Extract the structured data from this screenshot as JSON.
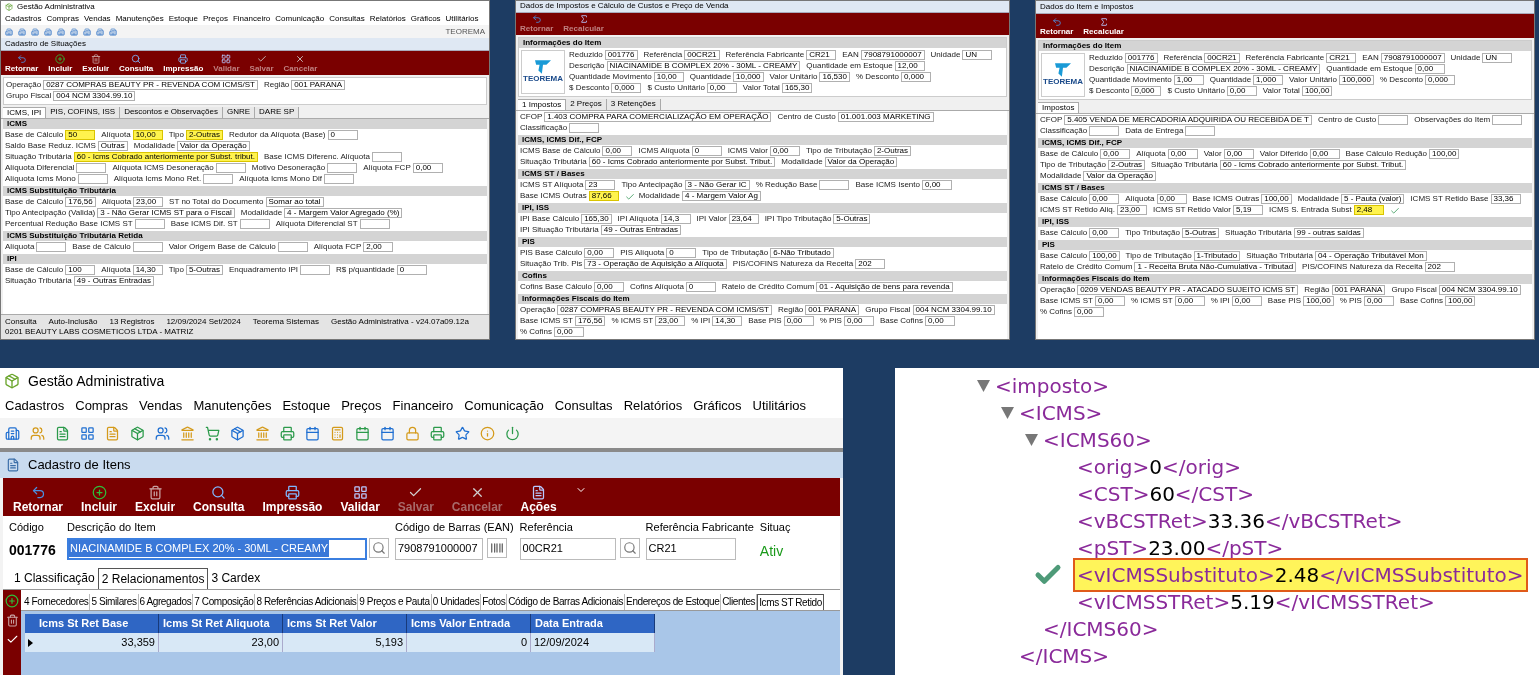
{
  "thumbnails": [
    {
      "app_title": "Gestão Administrativa",
      "menu": [
        "Cadastros",
        "Compras",
        "Vendas",
        "Manutenções",
        "Estoque",
        "Preços",
        "Financeiro",
        "Comunicação",
        "Consultas",
        "Relatórios",
        "Gráficos",
        "Utilitários"
      ],
      "brand": "TEOREMA",
      "window_title": "Cadastro de Situações",
      "check_mark": false,
      "toolbar": [
        {
          "label": "Retornar",
          "kind": "back",
          "disabled": false
        },
        {
          "label": "Incluir",
          "kind": "add",
          "disabled": false
        },
        {
          "label": "Excluir",
          "kind": "delete",
          "disabled": false
        },
        {
          "label": "Consulta",
          "kind": "search",
          "disabled": false
        },
        {
          "label": "Impressão",
          "kind": "print",
          "disabled": false
        },
        {
          "label": "Validar",
          "kind": "validate",
          "disabled": true
        },
        {
          "label": "Salvar",
          "kind": "save",
          "disabled": true
        },
        {
          "label": "Cancelar",
          "kind": "cancel",
          "disabled": true
        }
      ],
      "header": {
        "fields": [
          {
            "label": "Operação",
            "value": "0287 COMPRAS BEAUTY PR - REVENDA COM ICMS/ST",
            "highlighted": false
          },
          {
            "label": "Região",
            "value": "001 PARANA",
            "highlighted": false
          },
          {
            "label": "Grupo Fiscal",
            "value": "004 NCM 3304.99.10",
            "highlighted": false
          }
        ]
      },
      "tabs": [
        {
          "label": "ICMS, IPI",
          "selected": true
        },
        {
          "label": "PIS, COFINS, ISS",
          "selected": false
        },
        {
          "label": "Descontos e Observações",
          "selected": false
        },
        {
          "label": "GNRE",
          "selected": false
        },
        {
          "label": "DARE SP",
          "selected": false
        }
      ],
      "sections": [
        {
          "title": "ICMS",
          "fields": [
            {
              "label": "Base de Cálculo",
              "value": "50",
              "highlighted": true
            },
            {
              "label": "Alíquota",
              "value": "10,00",
              "highlighted": true
            },
            {
              "label": "Tipo",
              "value": "2-Outras",
              "highlighted": true
            },
            {
              "label": "Redutor da Alíquota (Base)",
              "value": "0",
              "highlighted": false
            },
            {
              "label": "Saldo Base Reduz. ICMS",
              "value": "Outras",
              "highlighted": false
            },
            {
              "label": "Modalidade",
              "value": "Valor da Operação",
              "highlighted": false
            },
            {
              "label": "Situação Tributária",
              "value": "60 - Icms Cobrado anteriormente por Subst. tribut.",
              "highlighted": true
            },
            {
              "label": "Base ICMS Diferenc. Alíquota",
              "highlighted": false
            },
            {
              "label": "Alíquota Diferencial",
              "highlighted": false
            },
            {
              "label": "Alíquota ICMS Desoneração",
              "highlighted": false
            },
            {
              "label": "Motivo Desoneração",
              "highlighted": false
            },
            {
              "label": "Alíquota FCP",
              "value": "0,00",
              "highlighted": false
            },
            {
              "label": "Alíquota Icms Mono",
              "highlighted": false
            },
            {
              "label": "Alíquota Icms Mono Ret.",
              "highlighted": false
            },
            {
              "label": "Alíquota Icms Mono Dif",
              "highlighted": false
            }
          ]
        },
        {
          "title": "ICMS Substituição Tributária",
          "fields": [
            {
              "label": "Base de Cálculo",
              "value": "176,56",
              "highlighted": false
            },
            {
              "label": "Alíquota",
              "value": "23,00",
              "highlighted": false
            },
            {
              "label": "ST no Total do Documento",
              "value": "Somar ao total",
              "highlighted": false
            },
            {
              "label": "Tipo Antecipação (Valida)",
              "value": "3 - Não Gerar ICMS ST para o Fiscal",
              "highlighted": false
            },
            {
              "label": "Modalidade",
              "value": "4 - Margem Valor Agregado (%)",
              "highlighted": false
            },
            {
              "label": "Percentual Redução Base ICMS ST",
              "highlighted": false
            },
            {
              "label": "Base ICMS Dif. ST",
              "highlighted": false
            },
            {
              "label": "Alíquota Diferencial ST",
              "highlighted": false
            }
          ]
        },
        {
          "title": "ICMS Substituição Tributária Retida",
          "fields": [
            {
              "label": "Alíquota",
              "highlighted": false
            },
            {
              "label": "Base de Cálculo",
              "highlighted": false
            },
            {
              "label": "Valor Origem Base de Cálculo",
              "highlighted": false
            },
            {
              "label": "Alíquota FCP",
              "value": "2,00",
              "highlighted": false
            }
          ]
        },
        {
          "title": "IPI",
          "fields": [
            {
              "label": "Base de Cálculo",
              "value": "100",
              "highlighted": false
            },
            {
              "label": "Alíquota",
              "value": "14,30",
              "highlighted": false
            },
            {
              "label": "Tipo",
              "value": "5-Outras",
              "highlighted": false
            },
            {
              "label": "Enquadramento IPI",
              "highlighted": false
            },
            {
              "label": "R$ p/quantidade",
              "value": "0",
              "highlighted": false
            },
            {
              "label": "Situação Tributária",
              "value": "49 - Outras Entradas",
              "highlighted": false
            }
          ]
        }
      ],
      "status_bar": [
        "Consulta",
        "Auto-Inclusão",
        "13 Registros",
        "12/09/2024 Set/2024",
        "Teorema Sistemas",
        "Gestão Administrativa - v24.07a09.12a",
        "0201 BEAUTY LABS COSMETICOS LTDA - MATRIZ"
      ]
    },
    {
      "window_title": "Dados de Impostos e Cálculo de Custos e Preço de Venda",
      "check_mark": true,
      "toolbar": [
        {
          "label": "Retornar",
          "kind": "back",
          "disabled": true
        },
        {
          "label": "Recalcular",
          "kind": "sum",
          "disabled": true
        }
      ],
      "header": {
        "title": "Informações do Item",
        "logo": "TEOREMA",
        "fields": [
          {
            "label": "Reduzido",
            "value": "001776",
            "highlighted": false
          },
          {
            "label": "Referência",
            "value": "00CR21",
            "highlighted": false
          },
          {
            "label": "Referência Fabricante",
            "value": "CR21",
            "highlighted": false
          },
          {
            "label": "EAN",
            "value": "7908791000007",
            "highlighted": false
          },
          {
            "label": "Unidade",
            "value": "UN",
            "highlighted": false
          },
          {
            "label": "Descrição",
            "value": "NIACINAMIDE B COMPLEX 20% - 30ML - CREAMY",
            "highlighted": false
          },
          {
            "label": "Quantidade em Estoque",
            "value": "12,00",
            "highlighted": false
          },
          {
            "label": "Quantidade Movimento",
            "value": "10,00",
            "highlighted": false
          },
          {
            "label": "Quantidade",
            "value": "10,000",
            "highlighted": false
          },
          {
            "label": "Valor Unitário",
            "value": "16,530",
            "highlighted": false
          },
          {
            "label": "% Desconto",
            "value": "0,000",
            "highlighted": false
          },
          {
            "label": "$ Desconto",
            "value": "0,000",
            "highlighted": false
          },
          {
            "label": "$ Custo Unitário",
            "value": "0,00",
            "highlighted": false
          },
          {
            "label": "Valor Total",
            "value": "165,30",
            "highlighted": false
          }
        ]
      },
      "tabs": [
        {
          "label": "1 Impostos",
          "selected": true
        },
        {
          "label": "2 Preços",
          "selected": false
        },
        {
          "label": "3 Retenções",
          "selected": false
        }
      ],
      "sections": [
        {
          "fields": [
            {
              "label": "CFOP",
              "value": "1.403 COMPRA PARA COMERCIALIZAÇÃO EM OPERAÇÃO",
              "highlighted": false
            },
            {
              "label": "Centro de Custo",
              "value": "01.001.003 MARKETING",
              "highlighted": false
            },
            {
              "label": "Classificação",
              "highlighted": false
            }
          ]
        },
        {
          "title": "ICMS, ICMS Dif., FCP",
          "fields": [
            {
              "label": "ICMS Base de Cálculo",
              "value": "0,00",
              "highlighted": false
            },
            {
              "label": "ICMS Alíquota",
              "value": "0",
              "highlighted": false
            },
            {
              "label": "ICMS Valor",
              "value": "0,00",
              "highlighted": false
            },
            {
              "label": "Tipo de Tributação",
              "value": "2-Outras",
              "highlighted": false
            },
            {
              "label": "Situação Tributária",
              "value": "60 - Icms Cobrado anteriormente por Subst. Tribut.",
              "highlighted": false
            },
            {
              "label": "Modalidade",
              "value": "Valor da Operação",
              "highlighted": false
            }
          ]
        },
        {
          "title": "ICMS ST / Bases",
          "fields": [
            {
              "label": "ICMS ST Alíquota",
              "value": "23",
              "highlighted": false
            },
            {
              "label": "Tipo Antecipação",
              "value": "3 - Não Gerar IC",
              "highlighted": false
            },
            {
              "label": "% Redução Base",
              "highlighted": false
            },
            {
              "label": "Base ICMS Isento",
              "value": "0,00",
              "highlighted": false
            },
            {
              "label": "Base ICMS Outras",
              "value": "87,66",
              "highlighted": true
            },
            {
              "label": "Modalidade",
              "value": "4 - Margem Valor Ag",
              "highlighted": false
            }
          ]
        },
        {
          "title": "IPI, ISS",
          "fields": [
            {
              "label": "IPI Base Cálculo",
              "value": "165,30",
              "highlighted": false
            },
            {
              "label": "IPI Alíquota",
              "value": "14,3",
              "highlighted": false
            },
            {
              "label": "IPI Valor",
              "value": "23,64",
              "highlighted": false
            },
            {
              "label": "IPI Tipo Tributação",
              "value": "5-Outras",
              "highlighted": false
            },
            {
              "label": "IPI Situação Tributária",
              "value": "49 - Outras Entradas",
              "highlighted": false
            }
          ]
        },
        {
          "title": "PIS",
          "fields": [
            {
              "label": "PIS Base Cálculo",
              "value": "0,00",
              "highlighted": false
            },
            {
              "label": "PIS Alíquota",
              "value": "0",
              "highlighted": false
            },
            {
              "label": "Tipo de Tributação",
              "value": "6-Não Tributado",
              "highlighted": false
            },
            {
              "label": "Situação Trib. Pis",
              "value": "73 - Operação de Aquisição a Alíquota",
              "highlighted": false
            },
            {
              "label": "PIS/COFINS Natureza da Receita",
              "value": "202",
              "highlighted": false
            }
          ]
        },
        {
          "title": "Cofins",
          "fields": [
            {
              "label": "Cofins Base Cálculo",
              "value": "0,00",
              "highlighted": false
            },
            {
              "label": "Cofins Alíquota",
              "value": "0",
              "highlighted": false
            },
            {
              "label": "Rateio de Crédito Comum",
              "value": "01 - Aquisição de bens para revenda",
              "highlighted": false
            }
          ]
        },
        {
          "title": "Informações Fiscais do Item",
          "fields": [
            {
              "label": "Operação",
              "value": "0287 COMPRAS BEAUTY PR - REVENDA COM ICMS/ST",
              "highlighted": false
            },
            {
              "label": "Região",
              "value": "001 PARANA",
              "highlighted": false
            },
            {
              "label": "Grupo Fiscal",
              "value": "004 NCM 3304.99.10",
              "highlighted": false
            },
            {
              "label": "Base ICMS ST",
              "value": "176,56",
              "highlighted": false
            },
            {
              "label": "% ICMS ST",
              "value": "23,00",
              "highlighted": false
            },
            {
              "label": "% IPI",
              "value": "14,30",
              "highlighted": false
            },
            {
              "label": "Base PIS",
              "value": "0,00",
              "highlighted": false
            },
            {
              "label": "% PIS",
              "value": "0,00",
              "highlighted": false
            },
            {
              "label": "Base Cofins",
              "value": "0,00",
              "highlighted": false
            },
            {
              "label": "% Cofins",
              "value": "0,00",
              "highlighted": false
            }
          ]
        }
      ]
    },
    {
      "window_title": "Dados do Item e Impostos",
      "check_mark": true,
      "toolbar": [
        {
          "label": "Retornar",
          "kind": "back",
          "disabled": false
        },
        {
          "label": "Recalcular",
          "kind": "sum",
          "disabled": false
        }
      ],
      "header": {
        "title": "Informações do Item",
        "logo": "TEOREMA",
        "fields": [
          {
            "label": "Reduzido",
            "value": "001776",
            "highlighted": false
          },
          {
            "label": "Referência",
            "value": "00CR21",
            "highlighted": false
          },
          {
            "label": "Referência Fabricante",
            "value": "CR21",
            "highlighted": false
          },
          {
            "label": "EAN",
            "value": "7908791000007",
            "highlighted": false
          },
          {
            "label": "Unidade",
            "value": "UN",
            "highlighted": false
          },
          {
            "label": "Descrição",
            "value": "NIACINAMIDE B COMPLEX 20% - 30ML - CREAMY",
            "highlighted": false
          },
          {
            "label": "Quantidade em Estoque",
            "value": "0,00",
            "highlighted": false
          },
          {
            "label": "Quantidade Movimento",
            "value": "1,00",
            "highlighted": false
          },
          {
            "label": "Quantidade",
            "value": "1,000",
            "highlighted": false
          },
          {
            "label": "Valor Unitário",
            "value": "100,000",
            "highlighted": false
          },
          {
            "label": "% Desconto",
            "value": "0,000",
            "highlighted": false
          },
          {
            "label": "$ Desconto",
            "value": "0,000",
            "highlighted": false
          },
          {
            "label": "$ Custo Unitário",
            "value": "0,00",
            "highlighted": false
          },
          {
            "label": "Valor Total",
            "value": "100,00",
            "highlighted": false
          }
        ]
      },
      "tabs": [
        {
          "label": "Impostos",
          "selected": true
        }
      ],
      "sections": [
        {
          "fields": [
            {
              "label": "CFOP",
              "value": "5.405 VENDA DE MERCADORIA ADQUIRIDA OU RECEBIDA DE T",
              "highlighted": false
            },
            {
              "label": "Centro de Custo",
              "highlighted": false
            },
            {
              "label": "Observações do Item",
              "highlighted": false
            },
            {
              "label": "Classificação",
              "highlighted": false
            },
            {
              "label": "Data de Entrega",
              "highlighted": false
            }
          ]
        },
        {
          "title": "ICMS, ICMS Dif., FCP",
          "fields": [
            {
              "label": "Base de Cálculo",
              "value": "0,00",
              "highlighted": false
            },
            {
              "label": "Alíquota",
              "value": "0,00",
              "highlighted": false
            },
            {
              "label": "Valor",
              "value": "0,00",
              "highlighted": false
            },
            {
              "label": "Valor Diferido",
              "value": "0,00",
              "highlighted": false
            },
            {
              "label": "Base Cálculo Redução",
              "value": "100,00",
              "highlighted": false
            },
            {
              "label": "Tipo de Tributação",
              "value": "2-Outras",
              "highlighted": false
            },
            {
              "label": "Situação Tributária",
              "value": "60 - Icms Cobrado anteriormente por Subst. Tribut.",
              "highlighted": false
            },
            {
              "label": "Modalidade",
              "value": "Valor da Operação",
              "highlighted": false
            }
          ]
        },
        {
          "title": "ICMS ST / Bases",
          "fields": [
            {
              "label": "Base Cálculo",
              "value": "0,00",
              "highlighted": false
            },
            {
              "label": "Alíquota",
              "value": "0,00",
              "highlighted": false
            },
            {
              "label": "Base ICMS Outras",
              "value": "100,00",
              "highlighted": false
            },
            {
              "label": "Modalidade",
              "value": "5 - Pauta (valor)",
              "highlighted": false
            },
            {
              "label": "ICMS ST Retido Base",
              "value": "33,36",
              "highlighted": false
            },
            {
              "label": "ICMS ST Retido Aliq.",
              "value": "23,00",
              "highlighted": false
            },
            {
              "label": "ICMS ST Retido Valor",
              "value": "5,19",
              "highlighted": false
            },
            {
              "label": "ICMS S. Entrada Subst",
              "value": "2,48",
              "highlighted": true
            }
          ]
        },
        {
          "title": "IPI, ISS",
          "fields": [
            {
              "label": "Base Cálculo",
              "value": "0,00",
              "highlighted": false
            },
            {
              "label": "Tipo Tributação",
              "value": "5-Outras",
              "highlighted": false
            },
            {
              "label": "Situação Tributária",
              "value": "99 - outras saídas",
              "highlighted": false
            }
          ]
        },
        {
          "title": "PIS",
          "fields": [
            {
              "label": "Base Cálculo",
              "value": "100,00",
              "highlighted": false
            },
            {
              "label": "Tipo de Tributação",
              "value": "1-Tributado",
              "highlighted": false
            },
            {
              "label": "Situação Tributária",
              "value": "04 - Operação Tributável Mon",
              "highlighted": false
            },
            {
              "label": "Rateio de Crédito Comum",
              "value": "1 - Receita Bruta Não-Cumulativa - Tributad",
              "highlighted": false
            },
            {
              "label": "PIS/COFINS Natureza da Receita",
              "value": "202",
              "highlighted": false
            }
          ]
        },
        {
          "title": "Informações Fiscais do Item",
          "fields": [
            {
              "label": "Operação",
              "value": "0209 VENDAS BEAUTY PR - ATACADO SUJEITO ICMS ST",
              "highlighted": false
            },
            {
              "label": "Região",
              "value": "001 PARANA",
              "highlighted": false
            },
            {
              "label": "Grupo Fiscal",
              "value": "004 NCM 3304.99.10",
              "highlighted": false
            },
            {
              "label": "Base ICMS ST",
              "value": "0,00",
              "highlighted": false
            },
            {
              "label": "% ICMS ST",
              "value": "0,00",
              "highlighted": false
            },
            {
              "label": "% IPI",
              "value": "0,00",
              "highlighted": false
            },
            {
              "label": "Base PIS",
              "value": "100,00",
              "highlighted": false
            },
            {
              "label": "% PIS",
              "value": "0,00",
              "highlighted": false
            },
            {
              "label": "Base Cofins",
              "value": "100,00",
              "highlighted": false
            },
            {
              "label": "% Cofins",
              "value": "0,00",
              "highlighted": false
            }
          ]
        }
      ]
    }
  ],
  "main": {
    "app_title": "Gestão Administrativa",
    "menu": [
      "Cadastros",
      "Compras",
      "Vendas",
      "Manutenções",
      "Estoque",
      "Preços",
      "Financeiro",
      "Comunicação",
      "Consultas",
      "Relatórios",
      "Gráficos",
      "Utilitários"
    ],
    "window_title": "Cadastro de Itens",
    "toolbar": [
      {
        "label": "Retornar",
        "kind": "back",
        "disabled": false
      },
      {
        "label": "Incluir",
        "kind": "add",
        "disabled": false
      },
      {
        "label": "Excluir",
        "kind": "delete",
        "disabled": false
      },
      {
        "label": "Consulta",
        "kind": "search",
        "disabled": false
      },
      {
        "label": "Impressão",
        "kind": "print",
        "disabled": false
      },
      {
        "label": "Validar",
        "kind": "validate",
        "disabled": false
      },
      {
        "label": "Salvar",
        "kind": "save",
        "disabled": true
      },
      {
        "label": "Cancelar",
        "kind": "cancel",
        "disabled": true
      },
      {
        "label": "Ações",
        "kind": "actions",
        "disabled": false
      }
    ],
    "codigo": {
      "label": "Código",
      "value": "001776"
    },
    "descricao": {
      "label": "Descrição do Item",
      "value": "NIACINAMIDE B COMPLEX 20% - 30ML - CREAMY"
    },
    "ean": {
      "label": "Código de Barras (EAN)",
      "value": "7908791000007"
    },
    "referencia": {
      "label": "Referência",
      "value": "00CR21"
    },
    "referencia_fabricante": {
      "label": "Referência Fabricante",
      "value": "CR21"
    },
    "situacao": {
      "label": "Situaç",
      "value": "Ativ"
    },
    "tabs": [
      {
        "label": "1 Classificação",
        "selected": false
      },
      {
        "label": "2 Relacionamentos",
        "selected": true
      },
      {
        "label": "3 Cardex",
        "selected": false
      }
    ],
    "subtabs": [
      {
        "label": "4 Fornecedores",
        "selected": false
      },
      {
        "label": "5 Similares",
        "selected": false
      },
      {
        "label": "6 Agregados",
        "selected": false
      },
      {
        "label": "7 Composição",
        "selected": false
      },
      {
        "label": "8 Referências Adicionais",
        "selected": false
      },
      {
        "label": "9 Preços e Pauta",
        "selected": false
      },
      {
        "label": "0 Unidades",
        "selected": false
      },
      {
        "label": "Fotos",
        "selected": false
      },
      {
        "label": "Código de Barras Adicionais",
        "selected": false
      },
      {
        "label": "Endereços de Estoque",
        "selected": false
      },
      {
        "label": "Clientes",
        "selected": false
      },
      {
        "label": "Icms ST Retido",
        "selected": true
      }
    ],
    "table": {
      "columns": [
        "Icms St Ret Base",
        "Icms St Ret Aliquota",
        "Icms St Ret Valor",
        "Icms Valor Entrada",
        "Data Entrada"
      ],
      "rows": [
        {
          "current": true,
          "cells": [
            "33,359",
            "23,00",
            "5,193",
            "0",
            "12/09/2024"
          ]
        }
      ]
    }
  },
  "xml": {
    "nodes": [
      {
        "open": "<imposto>",
        "expanded": true,
        "children": [
          {
            "open": "<ICMS>",
            "expanded": true,
            "close": "</ICMS>",
            "children": [
              {
                "open": "<ICMS60>",
                "expanded": true,
                "close": "</ICMS60>",
                "children": [
                  {
                    "open": "<orig>",
                    "value": "0",
                    "close": "</orig>",
                    "highlighted": false
                  },
                  {
                    "open": "<CST>",
                    "value": "60",
                    "close": "</CST>",
                    "highlighted": false
                  },
                  {
                    "open": "<vBCSTRet>",
                    "value": "33.36",
                    "close": "</vBCSTRet>",
                    "highlighted": false
                  },
                  {
                    "open": "<pST>",
                    "value": "23.00",
                    "close": "</pST>",
                    "highlighted": false
                  },
                  {
                    "open": "<vICMSSubstituto>",
                    "value": "2.48",
                    "close": "</vICMSSubstituto>",
                    "highlighted": true
                  },
                  {
                    "open": "<vICMSSTRet>",
                    "value": "5.19",
                    "close": "</vICMSSTRet>",
                    "highlighted": false
                  }
                ]
              }
            ]
          }
        ]
      }
    ]
  }
}
